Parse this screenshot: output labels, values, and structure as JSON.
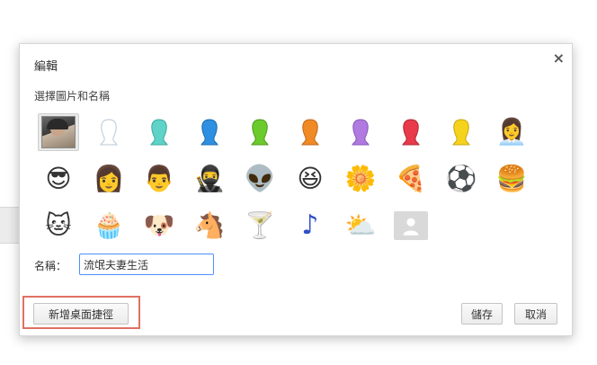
{
  "dialog": {
    "title": "編輯",
    "close_glyph": "×",
    "subtitle": "選擇圖片和名稱"
  },
  "avatars": [
    {
      "type": "photo",
      "name": "avatar-photo",
      "selected": true
    },
    {
      "type": "silhouette",
      "name": "avatar-white",
      "color": "#ffffff",
      "stroke": "#b8c8d8"
    },
    {
      "type": "silhouette",
      "name": "avatar-aqua",
      "color": "#5fd3c8",
      "stroke": "#3aa89e"
    },
    {
      "type": "silhouette",
      "name": "avatar-blue",
      "color": "#2f8fe0",
      "stroke": "#1c6bb0"
    },
    {
      "type": "silhouette",
      "name": "avatar-green",
      "color": "#6ccb2c",
      "stroke": "#4c9a1a"
    },
    {
      "type": "silhouette",
      "name": "avatar-orange",
      "color": "#f08a24",
      "stroke": "#c0661a"
    },
    {
      "type": "silhouette",
      "name": "avatar-purple",
      "color": "#b07ae0",
      "stroke": "#8556b8"
    },
    {
      "type": "silhouette",
      "name": "avatar-red",
      "color": "#e83a4a",
      "stroke": "#b02434"
    },
    {
      "type": "silhouette",
      "name": "avatar-yellow",
      "color": "#f5d21c",
      "stroke": "#c8a80e"
    },
    {
      "type": "emoji",
      "name": "avatar-businesswoman",
      "glyph": "👩‍💼"
    },
    {
      "type": "emoji",
      "name": "avatar-ninja-cool",
      "glyph": "😎"
    },
    {
      "type": "emoji",
      "name": "avatar-woman-sunglasses",
      "glyph": "👩"
    },
    {
      "type": "emoji",
      "name": "avatar-man",
      "glyph": "👨"
    },
    {
      "type": "emoji",
      "name": "avatar-ninja",
      "glyph": "🥷"
    },
    {
      "type": "emoji",
      "name": "avatar-alien",
      "glyph": "👽"
    },
    {
      "type": "emoji",
      "name": "avatar-smiley",
      "glyph": "😆"
    },
    {
      "type": "emoji",
      "name": "avatar-flower",
      "glyph": "🌼"
    },
    {
      "type": "emoji",
      "name": "avatar-pizza",
      "glyph": "🍕"
    },
    {
      "type": "emoji",
      "name": "avatar-soccer",
      "glyph": "⚽"
    },
    {
      "type": "emoji",
      "name": "avatar-burger",
      "glyph": "🍔"
    },
    {
      "type": "emoji",
      "name": "avatar-cat",
      "glyph": "🐱"
    },
    {
      "type": "emoji",
      "name": "avatar-cupcake",
      "glyph": "🧁"
    },
    {
      "type": "emoji",
      "name": "avatar-dog",
      "glyph": "🐶"
    },
    {
      "type": "emoji",
      "name": "avatar-horse",
      "glyph": "🐴"
    },
    {
      "type": "emoji",
      "name": "avatar-cocktail",
      "glyph": "🍸"
    },
    {
      "type": "emoji",
      "name": "avatar-music-note",
      "glyph": "♪"
    },
    {
      "type": "emoji",
      "name": "avatar-sun-cloud",
      "glyph": "⛅"
    },
    {
      "type": "generic",
      "name": "avatar-generic-person"
    }
  ],
  "name_field": {
    "label": "名稱：",
    "value": "流氓夫妻生活"
  },
  "buttons": {
    "create_shortcut": "新增桌面捷徑",
    "save": "儲存",
    "cancel": "取消"
  },
  "colors": {
    "focus_border": "#4d90fe",
    "highlight_box": "#e07163"
  }
}
